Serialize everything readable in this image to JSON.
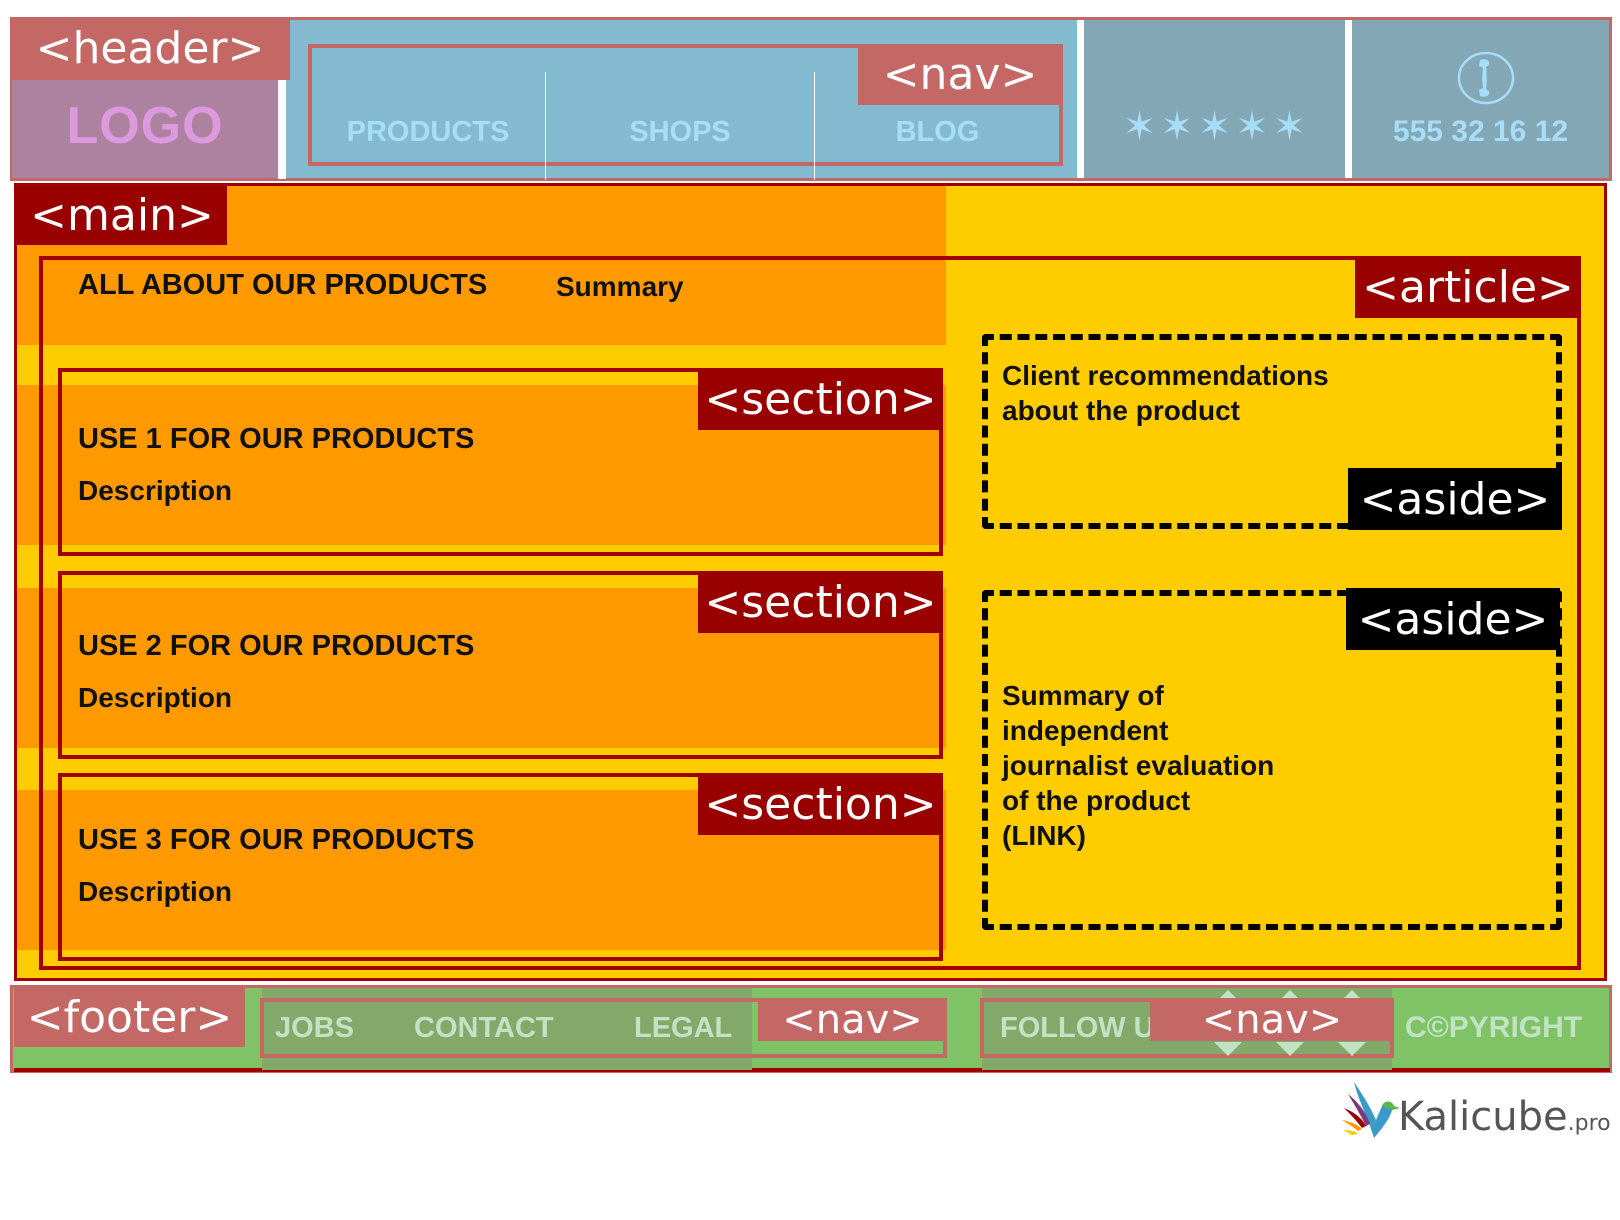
{
  "colors": {
    "header_label": "#c46866",
    "logo_panel": "#ac82a0",
    "logo_text": "#dd99dd",
    "nav_bg": "#84bad0",
    "nav_text": "#a6def9",
    "side_panel": "#83a7b5",
    "main_bg": "#ffcc00",
    "orange": "#ff9900",
    "dark_red": "#990000",
    "footer_bg": "#80c266",
    "footer_nav_bg": "#82a96a",
    "footer_text": "#c1e3c4"
  },
  "header": {
    "tag": "<header>",
    "logo": "LOGO",
    "nav": {
      "tag": "<nav>",
      "items": [
        {
          "label": "PRODUCTS"
        },
        {
          "label": "SHOPS"
        },
        {
          "label": "BLOG"
        }
      ]
    },
    "rating": {
      "icon": "star-icon",
      "stars": 5,
      "glyphs": "✶✶✶✶✶"
    },
    "phone": {
      "icon": "phone-icon",
      "number": "555 32 16 12"
    }
  },
  "main": {
    "tag": "<main>",
    "article": {
      "tag": "<article>",
      "title": "ALL ABOUT OUR PRODUCTS",
      "summary": "Summary",
      "sections": [
        {
          "tag": "<section>",
          "title": "USE 1 FOR OUR PRODUCTS",
          "description": "Description"
        },
        {
          "tag": "<section>",
          "title": "USE 2 FOR OUR PRODUCTS",
          "description": "Description"
        },
        {
          "tag": "<section>",
          "title": "USE 3 FOR OUR PRODUCTS",
          "description": "Description"
        }
      ],
      "asides": [
        {
          "tag": "<aside>",
          "lines": [
            "Client recommendations",
            "about the product"
          ]
        },
        {
          "tag": "<aside>",
          "lines": [
            "Summary of",
            "independent",
            "journalist evaluation",
            "of the product",
            "(LINK)"
          ]
        }
      ]
    }
  },
  "footer": {
    "tag": "<footer>",
    "nav_links": {
      "tag": "<nav>",
      "items": [
        {
          "label": "JOBS"
        },
        {
          "label": "CONTACT"
        },
        {
          "label": "LEGAL"
        }
      ]
    },
    "nav_social": {
      "tag": "<nav>",
      "label": "FOLLOW US:",
      "icons": [
        "social-icon-1",
        "social-icon-2",
        "social-icon-3"
      ]
    },
    "copyright": "C©PYRIGHT"
  },
  "brand": {
    "name": "Kalicube",
    "suffix": ".pro"
  }
}
